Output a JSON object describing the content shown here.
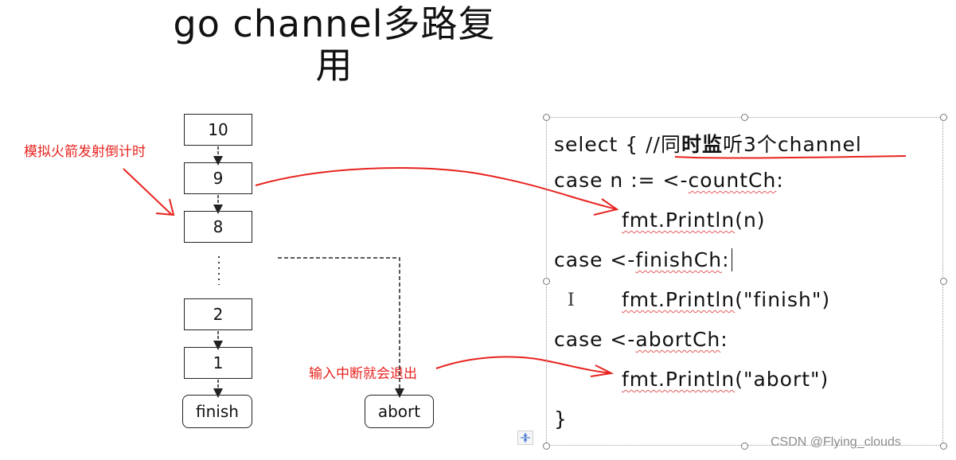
{
  "title": {
    "line1": "go channel多路复",
    "line2": "用"
  },
  "flowchart": {
    "boxes": [
      "10",
      "9",
      "8",
      "2",
      "1"
    ],
    "ellipsis": "⋮",
    "terminal_finish": "finish",
    "terminal_abort": "abort"
  },
  "annotations": {
    "countdown_note": "模拟火箭发射倒计时",
    "abort_note": "输入中断就会退出",
    "colors": {
      "annotation": "#e8231f"
    }
  },
  "code": {
    "line1_prefix": "select { //",
    "line1_c1": "同",
    "line1_bold": "时监",
    "line1_suffix": "听3个channel",
    "line2_prefix": "case n := <-",
    "line2_sq": "countCh",
    "line2_suffix": ":",
    "line3_sq": "fmt.Println",
    "line3_suffix": "(n)",
    "line4_prefix": "case <-",
    "line4_sq": "finishCh",
    "line4_suffix": ":",
    "line5_sq": "fmt.Println",
    "line5_suffix": "(\"finish\")",
    "line6_prefix": "case <-",
    "line6_sq": "abortCh",
    "line6_suffix": ":",
    "line7_sq": "fmt.Println",
    "line7_suffix": "(\"abort\")",
    "line8": "}"
  },
  "ui": {
    "text_cursor": "I",
    "layout_options_icon": "layout-options-icon",
    "watermark": "CSDN @Flying_clouds"
  }
}
